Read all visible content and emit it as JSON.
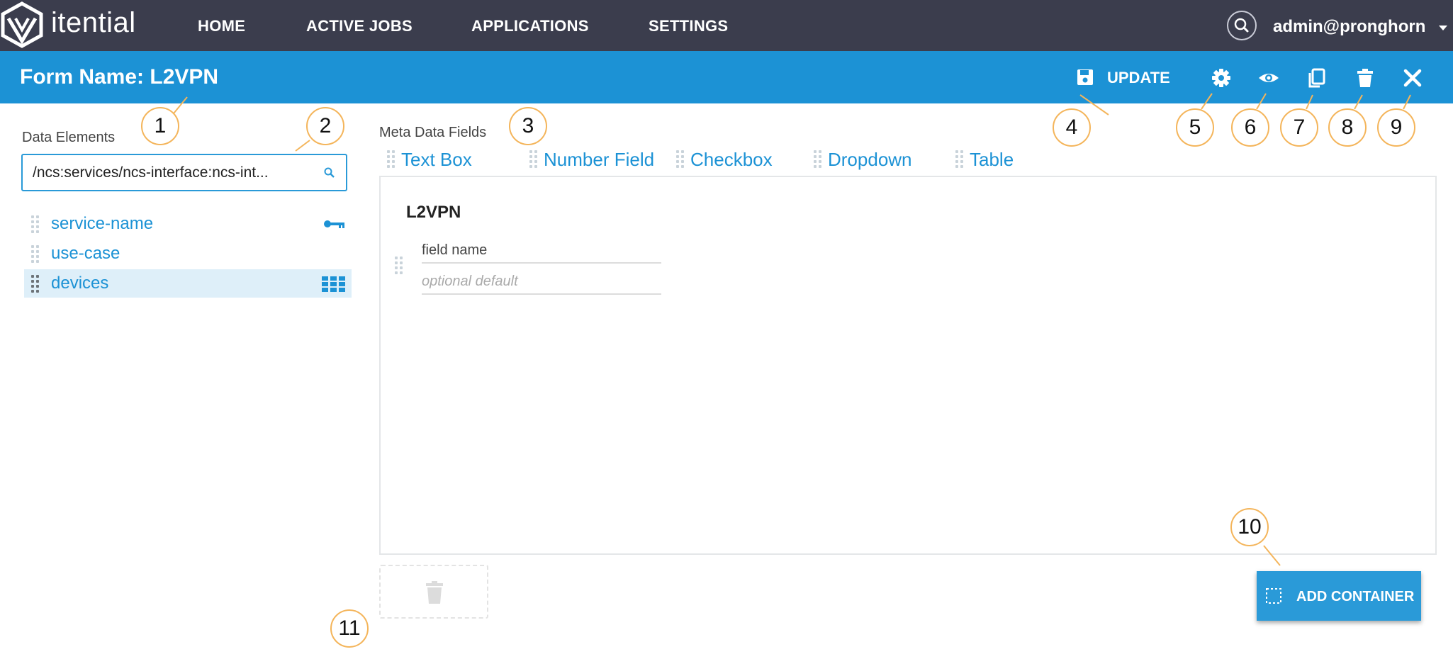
{
  "topbar": {
    "brand": "itential",
    "nav": [
      "HOME",
      "ACTIVE JOBS",
      "APPLICATIONS",
      "SETTINGS"
    ],
    "user": "admin@pronghorn"
  },
  "formbar": {
    "title": "Form Name: L2VPN",
    "update_label": "UPDATE",
    "icons": [
      "settings-icon",
      "preview-eye-icon",
      "duplicate-icon",
      "delete-icon",
      "close-icon"
    ]
  },
  "left_panel": {
    "label": "Data Elements",
    "search_value": "/ncs:services/ncs-interface:ncs-int...",
    "elements": [
      {
        "label": "service-name",
        "icon": "key-icon"
      },
      {
        "label": "use-case",
        "icon": ""
      },
      {
        "label": "devices",
        "icon": "table-grid-icon"
      }
    ]
  },
  "meta": {
    "label": "Meta Data Fields",
    "fields": [
      "Text Box",
      "Number Field",
      "Checkbox",
      "Dropdown",
      "Table"
    ]
  },
  "canvas": {
    "container_title": "L2VPN",
    "field_name_value": "field name",
    "default_placeholder": "optional default"
  },
  "add_container_label": "ADD CONTAINER",
  "callouts": [
    "1",
    "2",
    "3",
    "4",
    "5",
    "6",
    "7",
    "8",
    "9",
    "10",
    "11"
  ],
  "colors": {
    "topbar": "#3b3d4d",
    "accent": "#1c92d5",
    "callout_border": "#f4b55b",
    "selected_row": "#deeff9"
  }
}
